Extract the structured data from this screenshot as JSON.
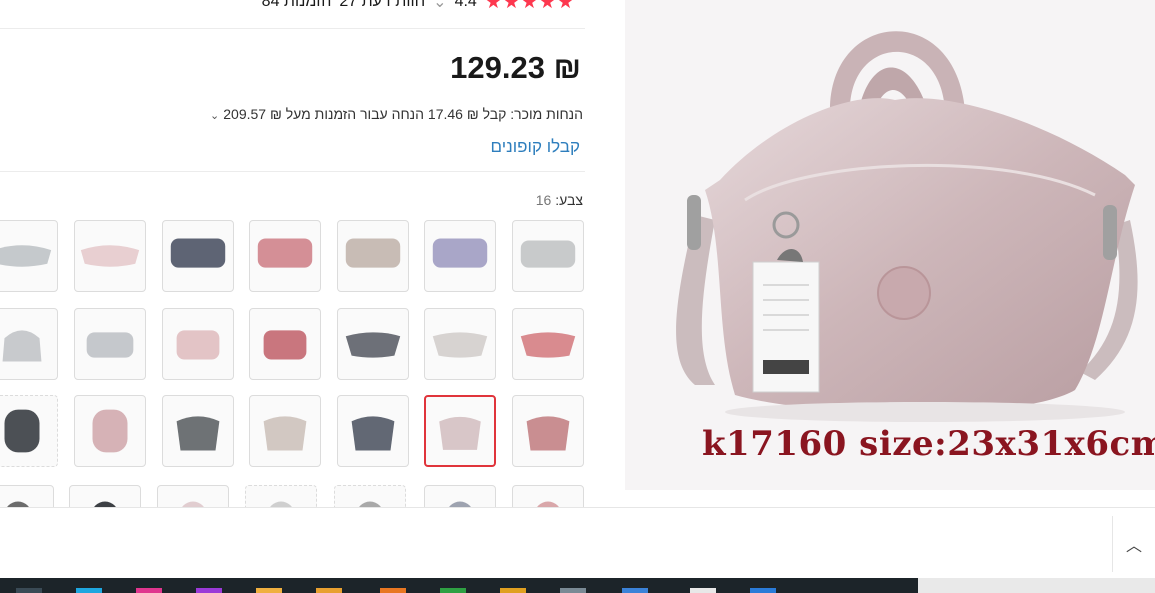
{
  "rating": {
    "stars": "★★★★★",
    "score": "4.4",
    "reviews": "27 חוות דעת",
    "orders": "84 הזמנות"
  },
  "price": "129.23 ₪",
  "discount": {
    "text": "הנחות מוכר: קבל ₪ 17.46 הנחה עבור הזמנות מעל ₪ 209.57",
    "chevron": "⌄"
  },
  "coupons_link": "קבלו קופונים",
  "color": {
    "label": "צבע:",
    "count": "16"
  },
  "main_image": {
    "caption": "k17160 size:23x31x6cm"
  },
  "scroll_top_icon": "chevron-up-icon",
  "colors": {
    "accent": "#fd384f",
    "link": "#2e7ebd",
    "selected_border": "#e0343b",
    "bag_main": "#d4c1c3"
  }
}
